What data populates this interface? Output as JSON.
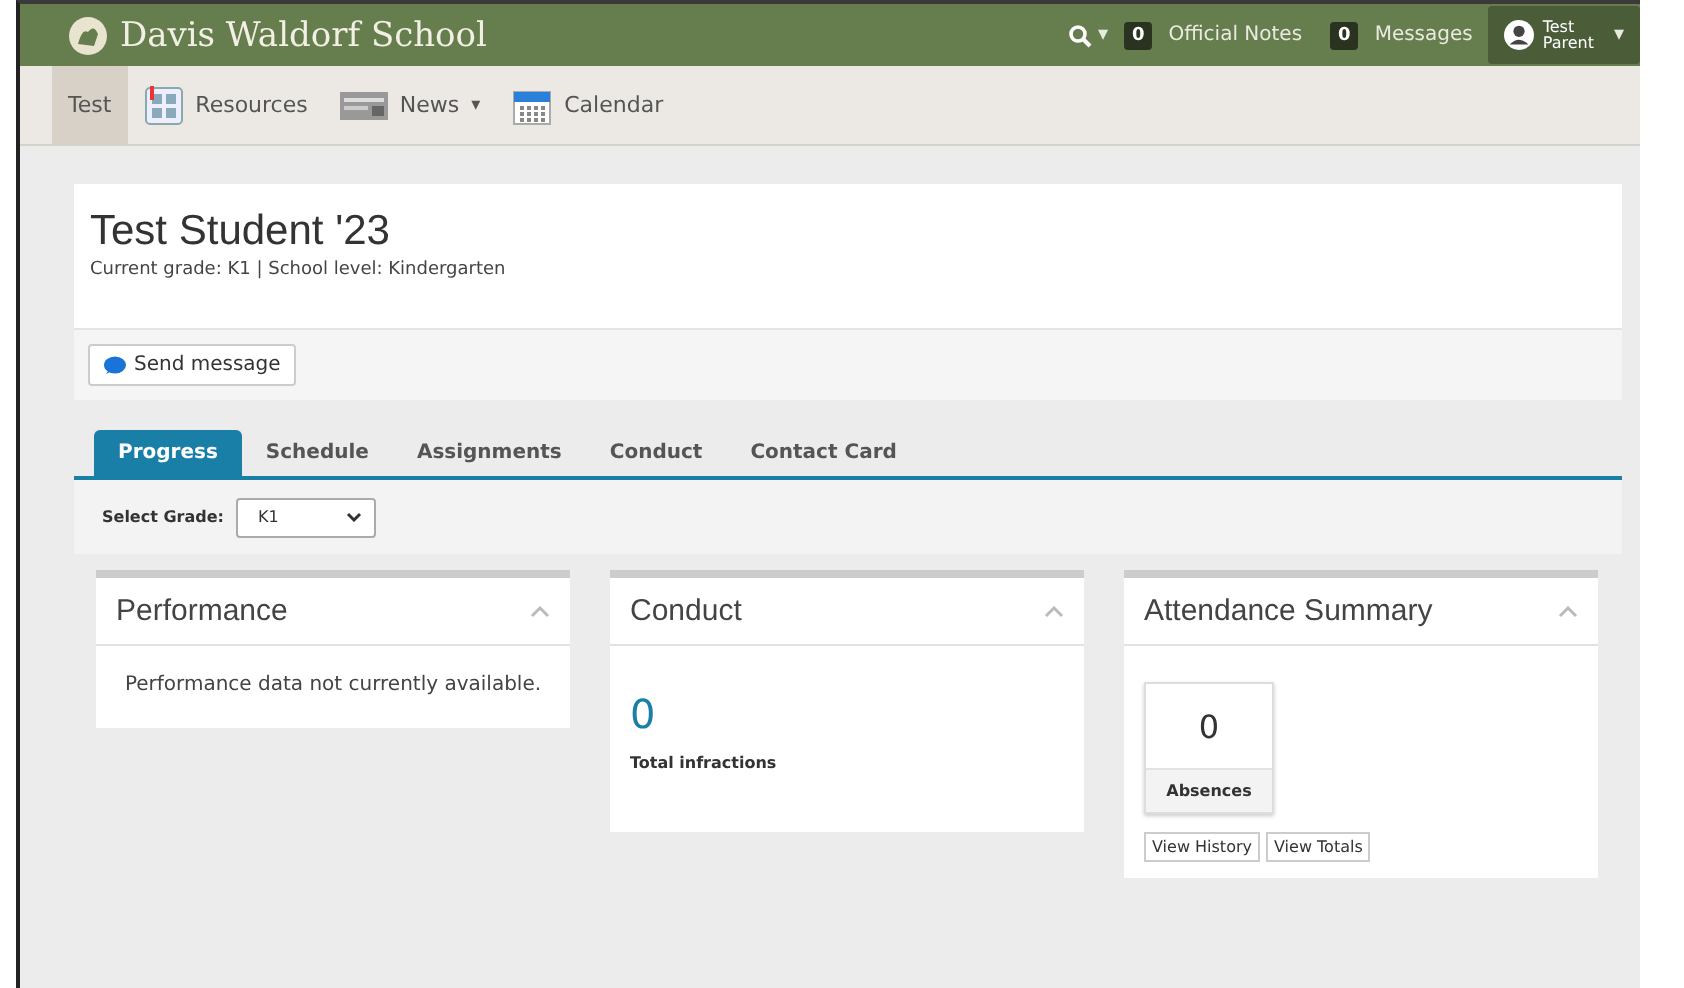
{
  "header": {
    "school_name": "Davis Waldorf School",
    "search_caret": "▾",
    "official_notes": {
      "count": "0",
      "label": "Official Notes"
    },
    "messages": {
      "count": "0",
      "label": "Messages"
    },
    "user": {
      "first": "Test",
      "last": "Parent",
      "caret": "▾"
    }
  },
  "nav": [
    {
      "label": "Test",
      "kind": "text",
      "selected": true
    },
    {
      "label": "Resources",
      "kind": "resources",
      "selected": false
    },
    {
      "label": "News",
      "kind": "news",
      "selected": false,
      "caret": "▾"
    },
    {
      "label": "Calendar",
      "kind": "calendar",
      "selected": false
    }
  ],
  "student": {
    "name": "Test Student '23",
    "details": "Current grade: K1 | School level: Kindergarten",
    "send_button": "Send message"
  },
  "tabs": [
    {
      "label": "Progress",
      "selected": true
    },
    {
      "label": "Schedule",
      "selected": false
    },
    {
      "label": "Assignments",
      "selected": false
    },
    {
      "label": "Conduct",
      "selected": false
    },
    {
      "label": "Contact Card",
      "selected": false
    }
  ],
  "grade_select": {
    "label": "Select Grade:",
    "value": "K1"
  },
  "panels": [
    {
      "kind": "message",
      "title": "Performance",
      "text": "Performance data not currently available."
    },
    {
      "kind": "stat",
      "title": "Conduct",
      "value": "0",
      "caption": "Total infractions"
    },
    {
      "kind": "tile",
      "title": "Attendance Summary",
      "value": "0",
      "caption": "Absences",
      "buttons": [
        "View History",
        "View Totals"
      ]
    }
  ]
}
